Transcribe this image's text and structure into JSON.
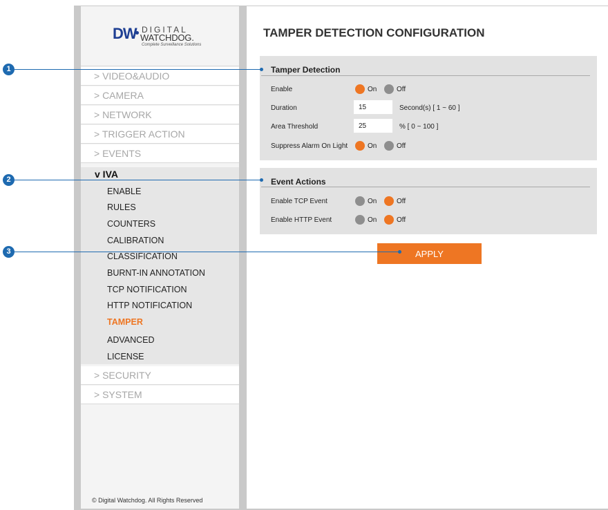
{
  "logo": {
    "mark": "DW",
    "line1": "DIGITAL",
    "line2": "WATCHDOG.",
    "tagline": "Complete Surveillance Solutions"
  },
  "sidebar": {
    "items_top": [
      "> VIDEO&AUDIO",
      "> CAMERA",
      "> NETWORK",
      "> TRIGGER ACTION",
      "> EVENTS"
    ],
    "open_section": "v IVA",
    "submenu": [
      "ENABLE",
      "RULES",
      "COUNTERS",
      "CALIBRATION",
      "CLASSIFICATION",
      "BURNT-IN ANNOTATION",
      "TCP NOTIFICATION",
      "HTTP NOTIFICATION",
      "TAMPER",
      "ADVANCED",
      "LICENSE"
    ],
    "active_submenu": "TAMPER",
    "items_bottom": [
      "> SECURITY",
      "> SYSTEM"
    ],
    "copyright": "© Digital Watchdog. All Rights Reserved"
  },
  "main": {
    "title": "TAMPER DETECTION CONFIGURATION",
    "tamper": {
      "heading": "Tamper Detection",
      "enable": {
        "label": "Enable",
        "on": "On",
        "off": "Off",
        "selected": "On"
      },
      "duration": {
        "label": "Duration",
        "value": "15",
        "hint": "Second(s) [ 1 ~ 60 ]"
      },
      "threshold": {
        "label": "Area Threshold",
        "value": "25",
        "hint": "% [ 0 ~ 100 ]"
      },
      "suppress": {
        "label": "Suppress Alarm On Light",
        "on": "On",
        "off": "Off",
        "selected": "On"
      }
    },
    "events": {
      "heading": "Event Actions",
      "tcp": {
        "label": "Enable TCP Event",
        "on": "On",
        "off": "Off",
        "selected": "Off"
      },
      "http": {
        "label": "Enable HTTP Event",
        "on": "On",
        "off": "Off",
        "selected": "Off"
      }
    },
    "apply_label": "APPLY"
  },
  "callouts": [
    "1",
    "2",
    "3"
  ],
  "colors": {
    "accent": "#ee7623",
    "callout": "#1e6ab0",
    "off_radio": "#8e8e8e"
  }
}
